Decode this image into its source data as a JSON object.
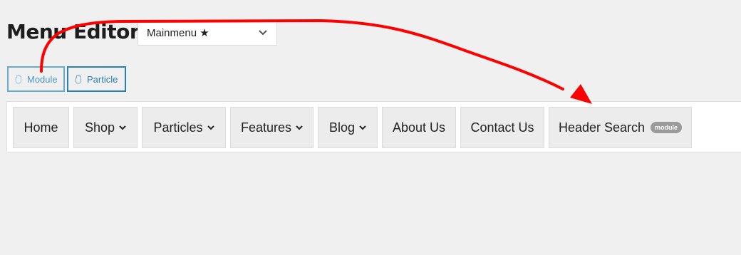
{
  "page": {
    "title": "Menu Editor"
  },
  "menu_select": {
    "value": "Mainmenu ★"
  },
  "palette": {
    "module_label": "Module",
    "particle_label": "Particle"
  },
  "menu_items": [
    {
      "label": "Home"
    },
    {
      "label": "Shop"
    },
    {
      "label": "Particles"
    },
    {
      "label": "Features"
    },
    {
      "label": "Blog"
    },
    {
      "label": "About Us"
    },
    {
      "label": "Contact Us"
    },
    {
      "label": "Header Search",
      "badge": "module"
    }
  ],
  "colors": {
    "accent": "#2a7fb3",
    "annotation": "#ff0000",
    "badge": "#9a9a9a"
  },
  "icons": {
    "select_chevron": "chevron-down-icon",
    "drag_handle": "hand-icon",
    "submenu_caret": "caret-down-icon"
  }
}
